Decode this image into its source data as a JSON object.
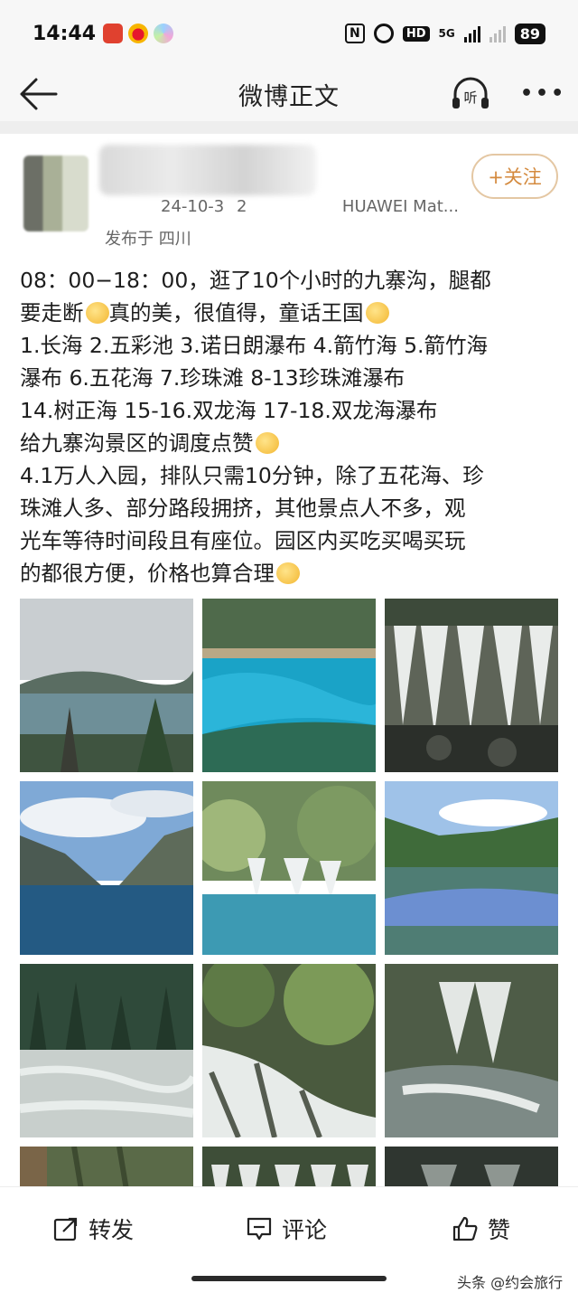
{
  "status_bar": {
    "time": "14:44",
    "app_icons": [
      "pinduoduo-app-icon",
      "weibo-app-icon",
      "colorful-app-icon"
    ],
    "network": "5G",
    "hd_label": "HD",
    "battery": "89"
  },
  "nav": {
    "title": "微博正文",
    "listen_label": "听",
    "more_label": "•••"
  },
  "author": {
    "date": "24-10-3",
    "date_suffix": "2",
    "device": "HUAWEI Mat...",
    "location": "发布于 四川",
    "follow_label": "+关注"
  },
  "post": {
    "line1": "08：00−18：00，逛了10个小时的九寨沟，腿都",
    "line2": "要走断",
    "line2b": "真的美，很值得，童话王国",
    "line3": "1.长海  2.五彩池 3.诺日朗瀑布 4.箭竹海 5.箭竹海",
    "line4": "瀑布  6.五花海  7.珍珠滩  8-13珍珠滩瀑布",
    "line5": "14.树正海  15-16.双龙海  17-18.双龙海瀑布",
    "line6": "给九寨沟景区的调度点赞",
    "line7": "4.1万人入园，排队只需10分钟，除了五花海、珍",
    "line8": "珠滩人多、部分路段拥挤，其他景点人不多，观",
    "line9": "光车等待时间段且有座位。园区内买吃买喝买玩",
    "line10": "的都很方便，价格也算合理"
  },
  "photos": [
    "long-lake-photo",
    "wucai-pool-photo",
    "nuorilang-waterfall-photo",
    "mountain-lake-photo",
    "waterfall-pool-photo",
    "reflection-lake-photo",
    "shoal-photo",
    "cascade-photo",
    "pearl-shoal-photo",
    "forest-photo",
    "waterfall-row-photo",
    "dark-waterfall-photo"
  ],
  "bottom": {
    "repost_label": "转发",
    "comment_label": "评论",
    "like_label": "赞",
    "watermark": "头条 @约会旅行"
  },
  "colors": {
    "follow_border": "#e4c7a3",
    "follow_text": "#d48a3e",
    "nav_bg": "#f7f7f7"
  }
}
